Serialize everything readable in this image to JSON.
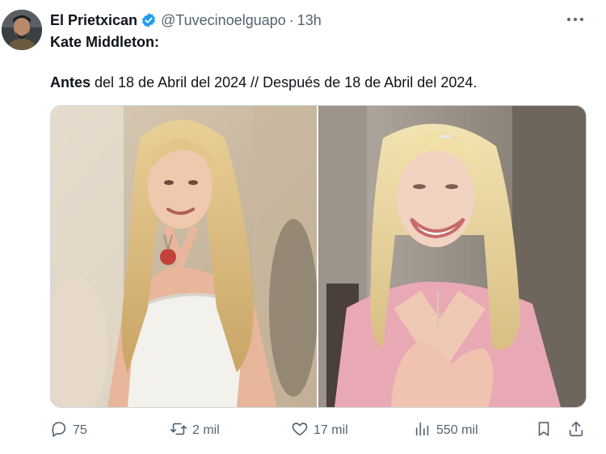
{
  "author": {
    "name": "El Prietxican",
    "handle": "@Tuvecinoelguapo",
    "separator": "·",
    "time": "13h",
    "verified": true
  },
  "tweet": {
    "line1": "Kate Middleton:",
    "line2_bold": "Antes",
    "line2_rest": " del 18 de Abril del 2024 // Después de 18 de Abril del 2024."
  },
  "media": {
    "left_description_icon": "photo",
    "right_description_icon": "photo"
  },
  "actions": {
    "reply_count": "75",
    "retweet_count": "2 mil",
    "like_count": "17 mil",
    "views_count": "550 mil"
  },
  "colors": {
    "text": "#0f1419",
    "secondary": "#536471",
    "verified_blue": "#1d9bf0",
    "border": "#cfd9de"
  },
  "icons": [
    "more-icon",
    "verified-icon",
    "reply-icon",
    "retweet-icon",
    "like-icon",
    "views-icon",
    "bookmark-icon",
    "share-icon"
  ]
}
